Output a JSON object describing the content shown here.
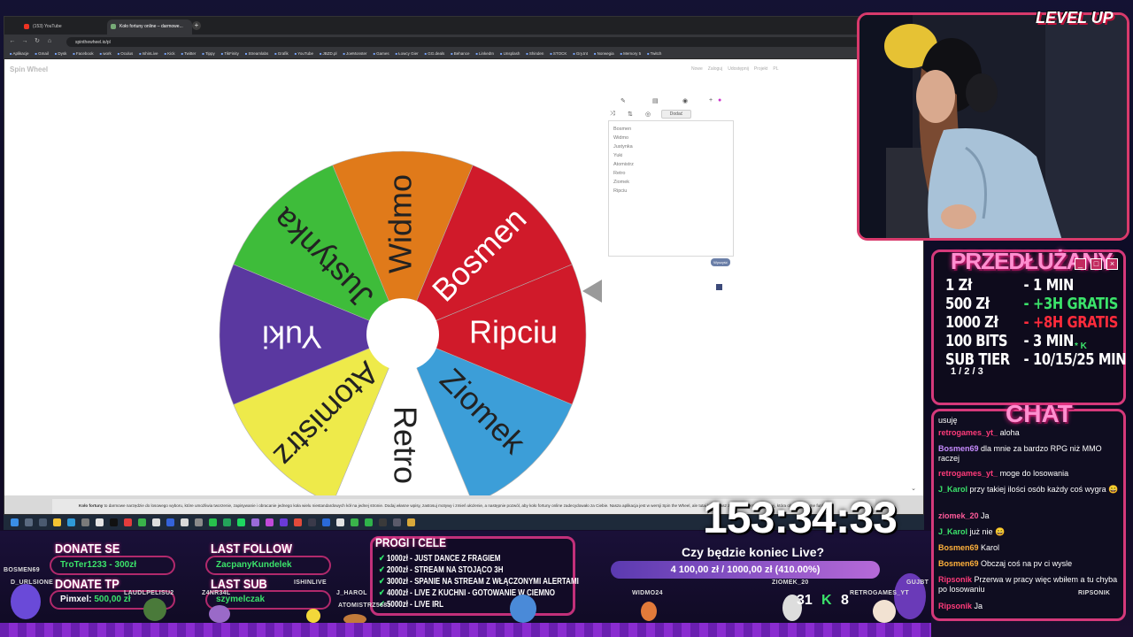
{
  "browser": {
    "tabs": [
      {
        "title": "(153) YouTube"
      },
      {
        "title": "Koło fortuny online – darmowe..."
      }
    ],
    "new_tab": "+",
    "url": "spinthewheel.io/pl",
    "bookmarks": [
      "Aplikacje",
      "Gmail",
      "Dysk",
      "Facebook",
      "work",
      "Oculus",
      "IshinLive",
      "Kick",
      "Twitter",
      "Tippy",
      "TikFinity",
      "Streamlabs",
      "Grafik",
      "YouTube",
      "JBZD.pl",
      "JoeMonster",
      "Games",
      "Łowcy Gier",
      "GG.deals",
      "Behance",
      "LinkedIn",
      "Unsplash",
      "Shinden",
      "STOCK",
      "Gry.tnt",
      "Norwegia",
      "Memory 5",
      "Twitch"
    ]
  },
  "site": {
    "logo": "Spin Wheel",
    "nav": [
      "Nowe",
      "Zaloguj",
      "Udostępnij",
      "Projekt",
      "PL"
    ],
    "add_button": "Dodać",
    "spin_badge": "Wyczyść",
    "footer_bold": "Koło fortuny",
    "footer_text": "to darmowe narzędzie do losowego wyboru, które umożliwia tworzenie, zapisywanie i obracanie jednego koła wielu niestandardowych kół na jednej stronie. Dodaj własne wpisy, zastosuj motywy i zmień ułożenie, a następnie pozwól, aby koło fortuny online zadecydowało za Ciebie. Nasza aplikacja jest w wersji Spin the Wheel, ale tutaj korzystasz z polskiej wersji językowej, która oferuje te same funkcje."
  },
  "wheel": {
    "entries": [
      "Bosmen",
      "Widmo",
      "Justynka",
      "Yuki",
      "Atomistrz",
      "Retro",
      "Ziomek",
      "Ripciu"
    ],
    "segments": [
      {
        "label": "Ripciu",
        "color": "#d01a2a",
        "text": "#ffffff"
      },
      {
        "label": "Ziomek",
        "color": "#3c9ed8",
        "text": "#222222"
      },
      {
        "label": "Retro",
        "color": "#ffffff",
        "text": "#222222"
      },
      {
        "label": "Atomistrz",
        "color": "#eeea4a",
        "text": "#222222"
      },
      {
        "label": "Yuki",
        "color": "#5a38a0",
        "text": "#ffffff"
      },
      {
        "label": "Justynka",
        "color": "#3ebc3a",
        "text": "#222222"
      },
      {
        "label": "Widmo",
        "color": "#e07a1a",
        "text": "#222222"
      },
      {
        "label": "Bosmen",
        "color": "#d01a2a",
        "text": "#ffffff"
      }
    ]
  },
  "extensions": {
    "title": "PRZEDŁUŻANY",
    "rows": [
      {
        "left": "1 Zł",
        "right": "- 1 MIN",
        "color": "#ffffff"
      },
      {
        "left": "500 Zł",
        "right": "- +3H GRATIS",
        "color": "#3be36a"
      },
      {
        "left": "1000 Zł",
        "right": "- +8H GRATIS",
        "color": "#ff2b3b"
      },
      {
        "left": "100 BITS",
        "right": "- 3 MIN",
        "color": "#ffffff"
      },
      {
        "left": "SUB TIER",
        "right": "- 10/15/25 MIN",
        "color": "#ffffff"
      }
    ],
    "sub_tier_levels": "1 / 2 / 3",
    "k_mark": "* K"
  },
  "chat": {
    "title": "CHAT",
    "messages": [
      {
        "user": "",
        "text": "usuję",
        "ucolor": "#ffffff"
      },
      {
        "user": "retrogames_yt_",
        "text": "aloha",
        "ucolor": "#ff3b7a"
      },
      {
        "user": "Bosmen69",
        "text": "dla mnie za bardzo RPG niż MMO raczej",
        "ucolor": "#c78cff"
      },
      {
        "user": "retrogames_yt_",
        "text": "moge do losowania",
        "ucolor": "#ff3b7a"
      },
      {
        "user": "J_Karol",
        "text": "przy takiej ilości osób każdy coś wygra 😄",
        "ucolor": "#3be36a"
      },
      {
        "user": "ziomek_20",
        "text": "Ja",
        "ucolor": "#ff5a9a"
      },
      {
        "user": "J_Karol",
        "text": "już nie 😄",
        "ucolor": "#3be36a"
      },
      {
        "user": "Bosmen69",
        "text": "Karol",
        "ucolor": "#ffb13b"
      },
      {
        "user": "Bosmen69",
        "text": "Obczaj coś na pv ci wysle",
        "ucolor": "#ffb13b"
      },
      {
        "user": "Ripsonik",
        "text": "Przerwa w pracy więc wbiłem a tu chyba po losowaniu",
        "ucolor": "#ff3b7a"
      },
      {
        "user": "Ripsonik",
        "text": "Ja",
        "ucolor": "#ff3b7a"
      }
    ]
  },
  "timer": "153:34:33",
  "donate_se": {
    "label": "DONATE SE",
    "value": "TroTer1233 - 300zł"
  },
  "donate_tp": {
    "label": "DONATE TP",
    "name": "Pimxel:",
    "amount": "500,00 zł"
  },
  "last_follow": {
    "label": "LAST FOLLOW",
    "value": "ZacpanyKundelek"
  },
  "last_sub": {
    "label": "LAST SUB",
    "value": "szymelczak"
  },
  "goals": {
    "title": "PROGI I CELE",
    "items": [
      "1000zł - JUST DANCE Z FRAGIEM",
      "2000zł - STREAM NA STOJĄCO 3H",
      "3000zł - SPANIE NA STREAM Z WŁĄCZONYMI ALERTAMI",
      "4000zł - LIVE Z KUCHNI - GOTOWANIE W CIEMNO",
      "5000zł - LIVE IRL"
    ]
  },
  "live_end": {
    "question": "Czy będzie koniec Live?",
    "progress": "4 100,00 zł / 1000,00 zł (410.00%)"
  },
  "bottom_tags": {
    "a": "BOSMEN69",
    "b": "D_URLSIONE",
    "c": "LAUDLPELISU2",
    "d": "Z4NR34L",
    "e": "ISHINLIVE",
    "f": "J_HAROL",
    "g": "ATOMISTRZ5683",
    "h": "WIDMO24",
    "i": "ZIOMEK_20",
    "j": "RETROGAMES_YT",
    "k": "GUJBT",
    "l": "RIPSONIK"
  },
  "counters": {
    "left": "31",
    "right": "8"
  },
  "overlay_logo": "LEVEL UP"
}
